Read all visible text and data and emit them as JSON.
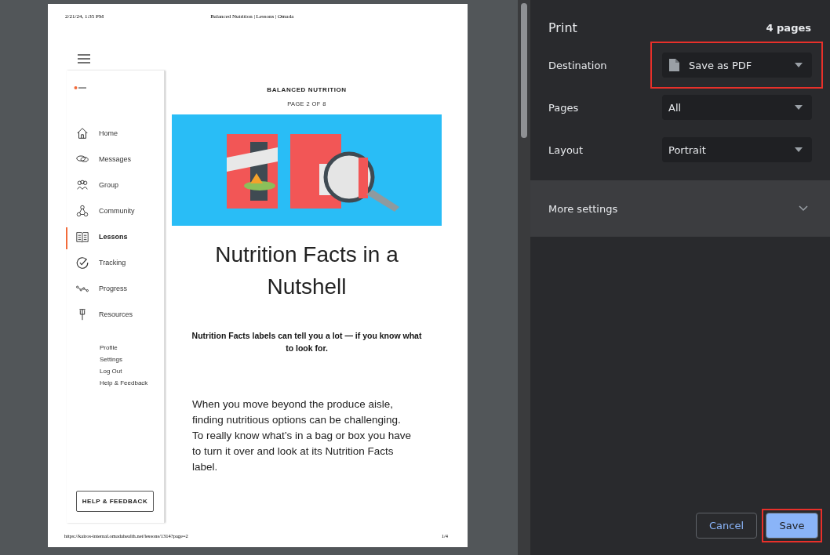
{
  "preview": {
    "header": {
      "date": "2/21/24, 1:35 PM",
      "title": "Balanced Nutrition | Lessons | Omada"
    },
    "sidebar": {
      "nav": [
        {
          "label": "Home",
          "selected": false
        },
        {
          "label": "Messages",
          "selected": false
        },
        {
          "label": "Group",
          "selected": false
        },
        {
          "label": "Community",
          "selected": false
        },
        {
          "label": "Lessons",
          "selected": true
        },
        {
          "label": "Tracking",
          "selected": false
        },
        {
          "label": "Progress",
          "selected": false
        },
        {
          "label": "Resources",
          "selected": false
        }
      ],
      "links": [
        "Profile",
        "Settings",
        "Log Out",
        "Help & Feedback"
      ],
      "button": "HELP & FEEDBACK"
    },
    "lesson": {
      "category": "BALANCED NUTRITION",
      "page": "PAGE 2 OF 8",
      "title": "Nutrition Facts in a Nutshell",
      "subtitle": "Nutrition Facts labels can tell you a lot — if you know what to look for.",
      "body": "When you move beyond the produce aisle, finding nutritious options can be challenging. To really know what’s in a bag or box you have to turn it over and look at its Nutrition Facts label."
    },
    "footer": {
      "url": "https://kairos-internal.omadahealth.net/lessons/1314?page=2",
      "page_number": "1/4"
    }
  },
  "print_panel": {
    "title": "Print",
    "page_count": "4 pages",
    "settings": [
      {
        "label": "Destination",
        "value": "Save as PDF",
        "kind": "file",
        "highlighted": true
      },
      {
        "label": "Pages",
        "value": "All",
        "kind": "plain",
        "highlighted": false
      },
      {
        "label": "Layout",
        "value": "Portrait",
        "kind": "plain",
        "highlighted": false
      }
    ],
    "more_settings": {
      "label": "More settings",
      "expanded": false
    },
    "buttons": [
      {
        "label": "Cancel",
        "kind": "secondary",
        "highlighted": false
      },
      {
        "label": "Save",
        "kind": "primary",
        "highlighted": true
      }
    ]
  }
}
